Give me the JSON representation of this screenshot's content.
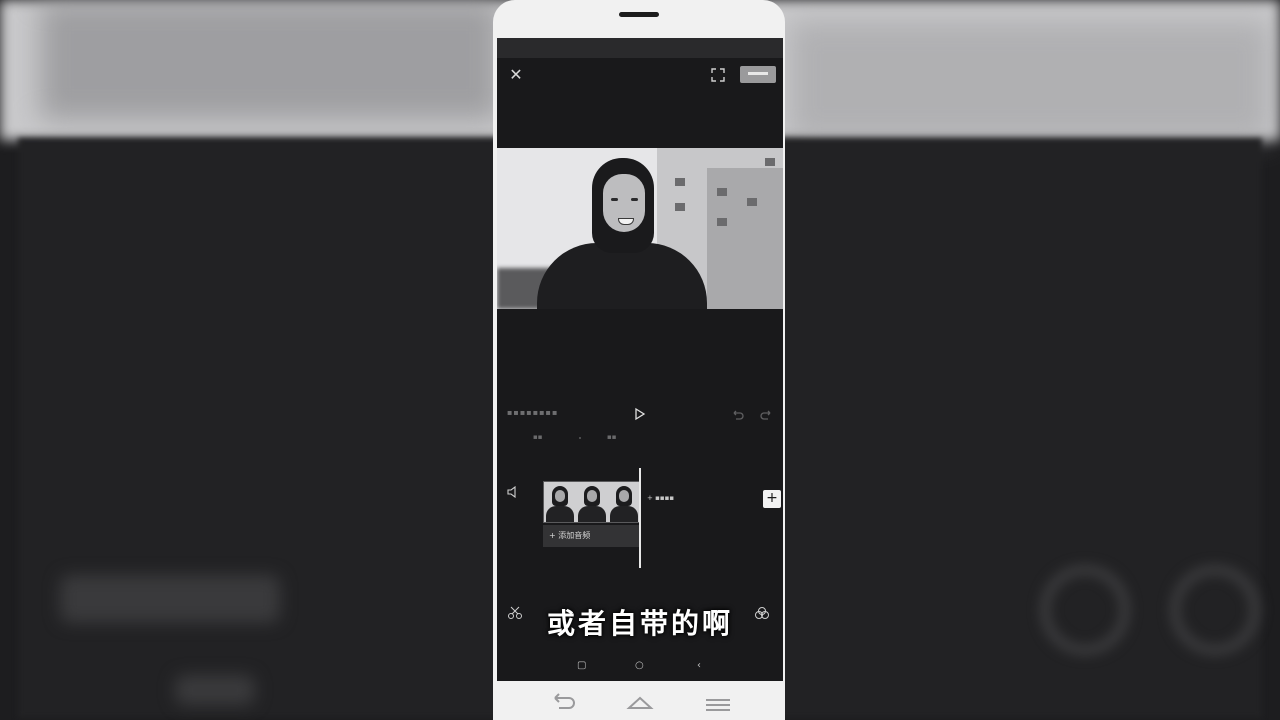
{
  "editor": {
    "close_icon": "close-icon",
    "fullscreen_icon": "fullscreen-icon",
    "export_icon": "export-icon"
  },
  "subtitle": {
    "text": "或者自带的啊"
  },
  "timeline": {
    "add_audio_label": "+ 添加音频",
    "add_clip_symbol": "+"
  },
  "softkeys": {
    "recent": "▢",
    "home": "○",
    "back": "‹"
  },
  "colors": {
    "screen_bg": "#19191b",
    "phone_frame": "#f1f1f1",
    "subtitle": "#ffffff"
  }
}
